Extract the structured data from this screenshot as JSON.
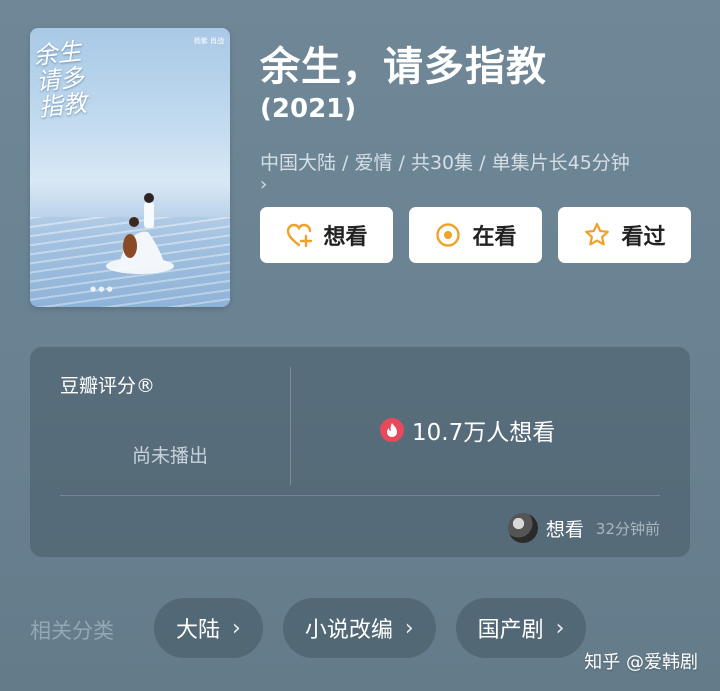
{
  "poster": {
    "title_art": "余生请多指教",
    "cast": "杨紫 肖战"
  },
  "header": {
    "title": "余生，请多指教",
    "year": "(2021)",
    "meta": "中国大陆 / 爱情 / 共30集 / 单集片长45分钟",
    "meta_more": "›"
  },
  "actions": {
    "want": "想看",
    "watching": "在看",
    "watched": "看过"
  },
  "rating": {
    "label": "豆瓣评分®",
    "status": "尚未播出",
    "want_count": "10.7万人想看",
    "activity_action": "想看",
    "activity_time": "32分钟前"
  },
  "categories": {
    "label": "相关分类",
    "items": [
      {
        "label": "大陆"
      },
      {
        "label": "小说改编"
      },
      {
        "label": "国产剧"
      }
    ],
    "chevron": "›"
  },
  "watermark": "知乎 @爱韩剧",
  "colors": {
    "background": "#6a8393",
    "heart_icon": "#f0a12a",
    "fire_badge": "#e8495b"
  }
}
